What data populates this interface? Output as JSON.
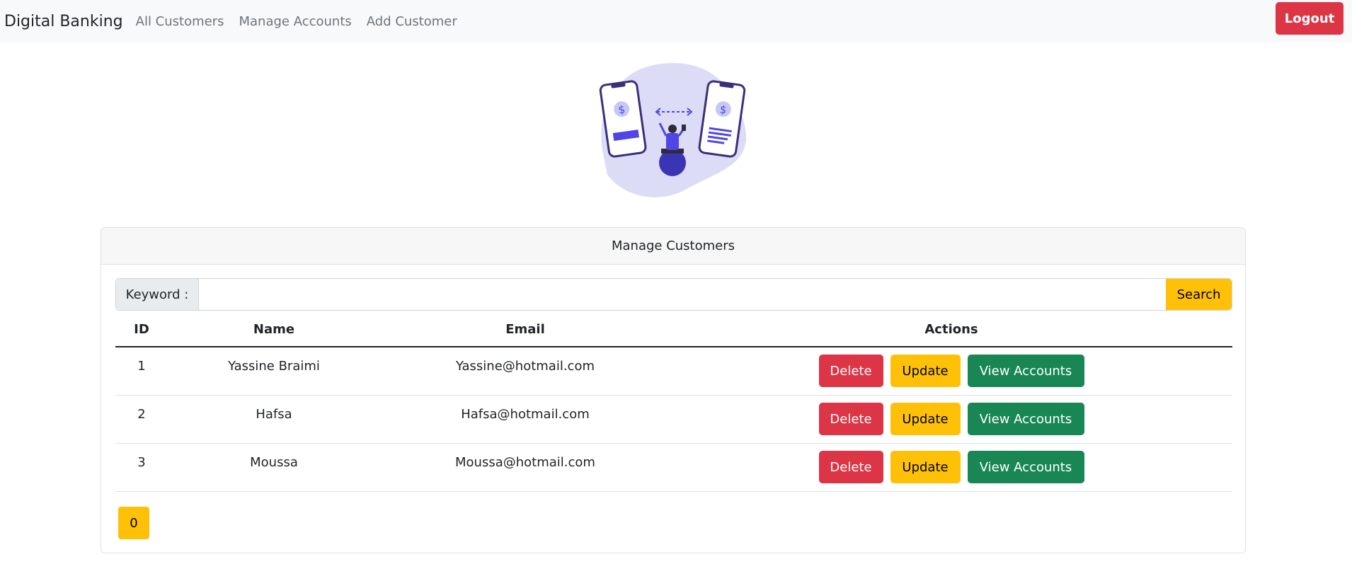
{
  "navbar": {
    "brand": "Digital Banking",
    "links": [
      "All Customers",
      "Manage Accounts",
      "Add Customer"
    ],
    "logout_label": "Logout"
  },
  "illustration": {
    "icon": "mobile-money-transfer-illustration",
    "accent_color": "#4f46e5",
    "blob_color": "#dcdcf7"
  },
  "card": {
    "title": "Manage Customers",
    "search": {
      "label": "Keyword :",
      "value": "",
      "button_label": "Search"
    },
    "table": {
      "headers": [
        "ID",
        "Name",
        "Email",
        "Actions"
      ],
      "rows": [
        {
          "id": "1",
          "name": "Yassine Braimi",
          "email": "Yassine@hotmail.com"
        },
        {
          "id": "2",
          "name": "Hafsa",
          "email": "Hafsa@hotmail.com"
        },
        {
          "id": "3",
          "name": "Moussa",
          "email": "Moussa@hotmail.com"
        }
      ],
      "actions": {
        "delete_label": "Delete",
        "update_label": "Update",
        "view_label": "View Accounts"
      }
    },
    "pagination": {
      "current_page": "0"
    }
  },
  "colors": {
    "danger": "#dc3545",
    "warning": "#ffc107",
    "success": "#198754"
  }
}
